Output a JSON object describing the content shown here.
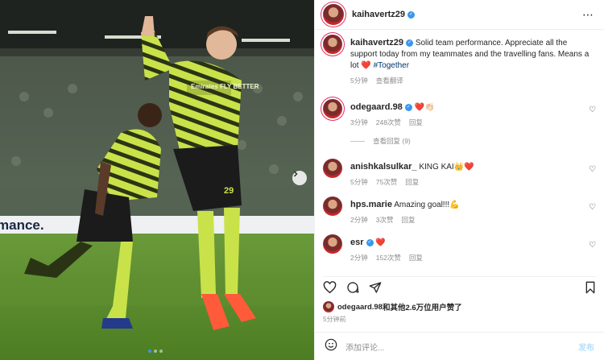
{
  "post": {
    "author": "kaihavertz29",
    "caption": "Solid team performance. Appreciate all the support today from my teammates and the travelling fans. Means a lot ❤️",
    "hashtag": "#Together",
    "caption_time": "5分钟",
    "translate": "查看翻译"
  },
  "photo": {
    "banner_text": "mance.",
    "shirt_text": "Emirates FLY BETTER",
    "number": "29",
    "carousel_total": 3,
    "carousel_active": 1
  },
  "comments": [
    {
      "user": "odegaard.98",
      "verified": true,
      "text": "❤️👏🏻",
      "time": "3分钟",
      "likes": "248次赞",
      "reply": "回复"
    },
    {
      "user": "anishkalsulkar_",
      "verified": false,
      "text": "KING KAI👑❤️",
      "time": "5分钟",
      "likes": "75次赞",
      "reply": "回复"
    },
    {
      "user": "hps.marie",
      "verified": false,
      "text": "Amazing goal!!!💪",
      "time": "2分钟",
      "likes": "3次赞",
      "reply": "回复"
    },
    {
      "user": "esr",
      "verified": true,
      "text": "❤️",
      "time": "2分钟",
      "likes": "152次赞",
      "reply": "回复"
    }
  ],
  "view_replies": "查看回复 (9)",
  "likes_line": {
    "user": "odegaard.98",
    "suffix": "和其他2.6万位用户赞了"
  },
  "post_time": "5分钟前",
  "add_comment": {
    "placeholder": "添加评论...",
    "post_label": "发布"
  },
  "icons": {
    "more": "more-icon",
    "heart": "heart-icon",
    "comment": "comment-icon",
    "share": "share-icon",
    "bookmark": "bookmark-icon",
    "emoji": "emoji-icon",
    "next": "chevron-right-icon"
  },
  "colors": {
    "accent": "#3897f0",
    "link": "#00376b",
    "muted": "#8e8e8e",
    "heart": "#ed4956"
  }
}
